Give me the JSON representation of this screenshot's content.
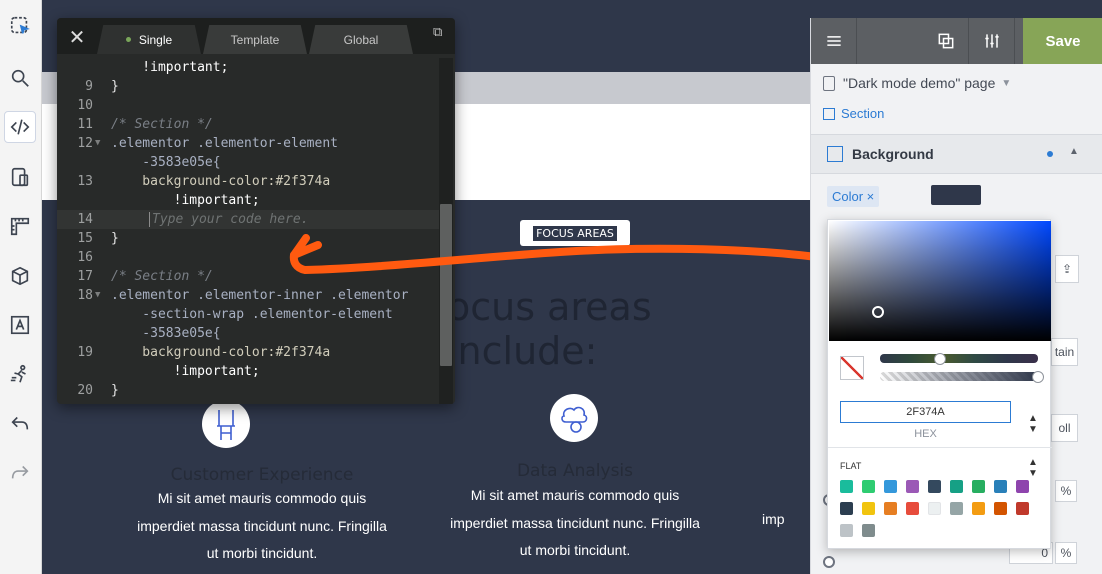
{
  "preview": {
    "focus_badge": "FOCUS AREAS",
    "headline": "ocus areas include:",
    "features": [
      {
        "title": "Customer Experience",
        "lines": [
          "Mi sit amet mauris commodo quis",
          "imperdiet massa tincidunt nunc. Fringilla",
          "ut morbi tincidunt."
        ]
      },
      {
        "title": "Data Analysis",
        "lines": [
          "Mi sit amet mauris commodo quis",
          "imperdiet massa tincidunt nunc. Fringilla",
          "ut morbi tincidunt."
        ]
      },
      {
        "title": "",
        "lines": [
          "",
          "imp",
          ""
        ]
      }
    ]
  },
  "editor": {
    "tabs": [
      "Single",
      "Template",
      "Global"
    ],
    "active_tab": "Single",
    "lines": [
      {
        "n": "",
        "text": "    !important;"
      },
      {
        "n": "9",
        "text": "}"
      },
      {
        "n": "10",
        "text": ""
      },
      {
        "n": "11",
        "text": "/* Section */"
      },
      {
        "n": "12",
        "text": ".elementor .elementor-element",
        "fold": true
      },
      {
        "n": "",
        "text": "    -3583e05e{"
      },
      {
        "n": "13",
        "text": "    background-color:#2f374a"
      },
      {
        "n": "",
        "text": "        !important;"
      },
      {
        "n": "14",
        "text": "Type your code here.",
        "highlight": true
      },
      {
        "n": "15",
        "text": "}"
      },
      {
        "n": "16",
        "text": ""
      },
      {
        "n": "17",
        "text": "/* Section */"
      },
      {
        "n": "18",
        "text": ".elementor .elementor-inner .elementor",
        "fold": true
      },
      {
        "n": "",
        "text": "    -section-wrap .elementor-element"
      },
      {
        "n": "",
        "text": "    -3583e05e{"
      },
      {
        "n": "19",
        "text": "    background-color:#2f374a"
      },
      {
        "n": "",
        "text": "        !important;"
      },
      {
        "n": "20",
        "text": "}"
      }
    ]
  },
  "panel": {
    "save_label": "Save",
    "page_label": "\"Dark mode demo\" page",
    "section_label": "Section",
    "background_label": "Background",
    "color_tag": "Color ×",
    "side_controls": [
      "tain",
      "oll",
      "%",
      "%",
      "0"
    ]
  },
  "picker": {
    "hex_value": "2F374A",
    "hex_label": "HEX",
    "palette_label": "FLAT",
    "current_color": "#2f374a",
    "palette": [
      "#1abc9c",
      "#2ecc71",
      "#3498db",
      "#9b59b6",
      "#34495e",
      "#16a085",
      "#27ae60",
      "#2980b9",
      "#8e44ad",
      "#2c3e50",
      "#f1c40f",
      "#e67e22",
      "#e74c3c",
      "#ecf0f1",
      "#95a5a6",
      "#f39c12",
      "#d35400",
      "#c0392b",
      "#bdc3c7",
      "#7f8c8d"
    ]
  },
  "colors": {
    "accent": "#2c7bd3",
    "save_green": "#87a557",
    "annotation_orange": "#ff5a10",
    "section_bg": "#2f374a"
  },
  "toolbar_icons": [
    "select-icon",
    "search-icon",
    "code-icon",
    "responsive-icon",
    "ruler-icon",
    "box-icon",
    "font-icon",
    "animation-icon",
    "undo-icon",
    "redo-icon"
  ]
}
